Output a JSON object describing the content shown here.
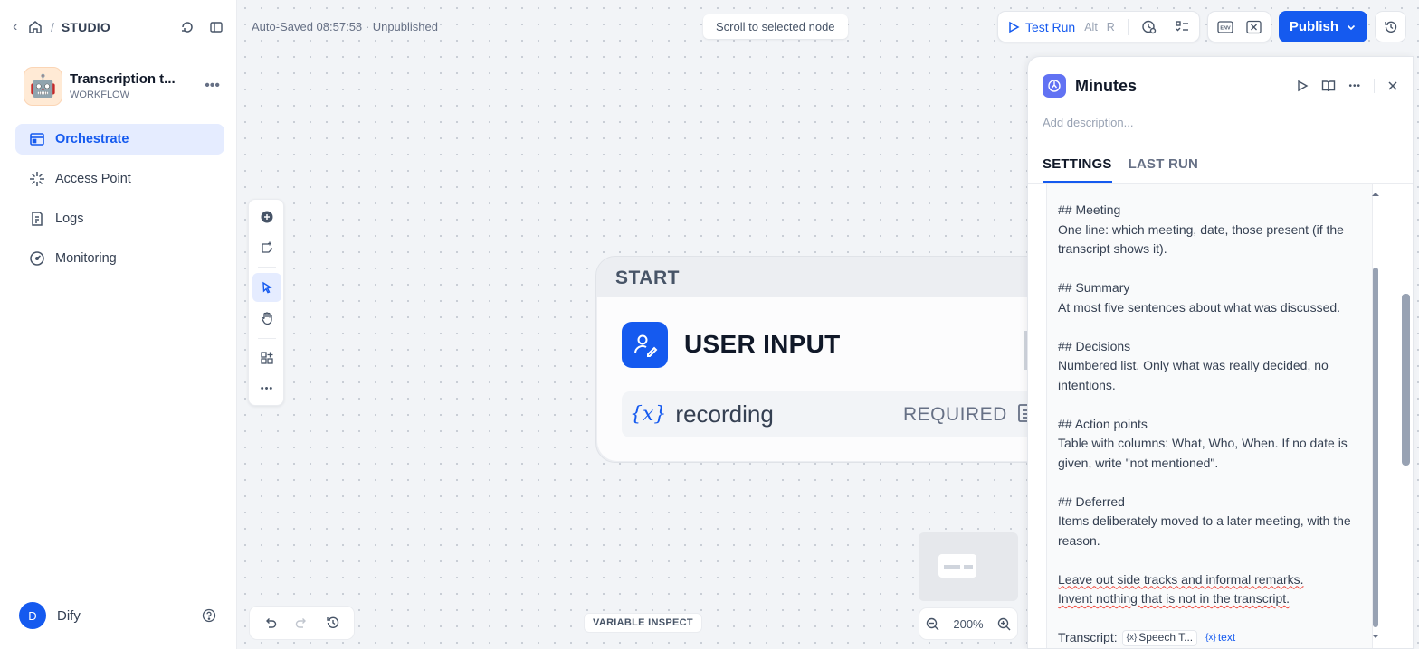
{
  "sidebar": {
    "breadcrumb": "STUDIO",
    "app": {
      "name": "Transcription t...",
      "type": "WORKFLOW",
      "icon": "robot-emoji"
    },
    "nav": [
      {
        "label": "Orchestrate",
        "icon": "orchestrate-icon",
        "active": true
      },
      {
        "label": "Access Point",
        "icon": "access-point-icon",
        "active": false
      },
      {
        "label": "Logs",
        "icon": "logs-icon",
        "active": false
      },
      {
        "label": "Monitoring",
        "icon": "monitoring-icon",
        "active": false
      }
    ],
    "user": {
      "initial": "D",
      "name": "Dify"
    }
  },
  "canvas": {
    "autosave": "Auto-Saved 08:57:58 · Unpublished",
    "scroll_to_selected": "Scroll to selected node",
    "test_run": {
      "label": "Test Run",
      "shortcut_1": "Alt",
      "shortcut_2": "R"
    },
    "publish": "Publish",
    "start_node": {
      "header": "START",
      "title": "USER INPUT",
      "variable_symbol": "{x}",
      "variable": "recording",
      "required": "REQUIRED"
    },
    "variable_inspect": "VARIABLE INSPECT",
    "zoom": "200%",
    "accent_color": "#155aef"
  },
  "panel": {
    "title": "Minutes",
    "description_placeholder": "Add description...",
    "tabs": [
      "SETTINGS",
      "LAST RUN"
    ],
    "prompt": {
      "p1": {
        "heading": "## Meeting",
        "body": "One line: which meeting, date, those present (if the transcript shows it)."
      },
      "p2": {
        "heading": "## Summary",
        "body": "At most five sentences about what was discussed."
      },
      "p3": {
        "heading": "## Decisions",
        "body": "Numbered list. Only what was really decided, no intentions."
      },
      "p4": {
        "heading": "## Action points",
        "body": "Table with columns: What, Who, When. If no date is given, write \"not mentioned\"."
      },
      "p5": {
        "heading": "## Deferred",
        "body": "Items deliberately moved to a later meeting, with the reason."
      },
      "p6": {
        "line1": "Leave out side tracks and informal remarks.",
        "line2": "Invent nothing that is not in the transcript."
      },
      "transcript_label": "Transcript:",
      "chip_1": "Speech T...",
      "chip_2": "text",
      "chip_symbol": "{x}"
    }
  }
}
